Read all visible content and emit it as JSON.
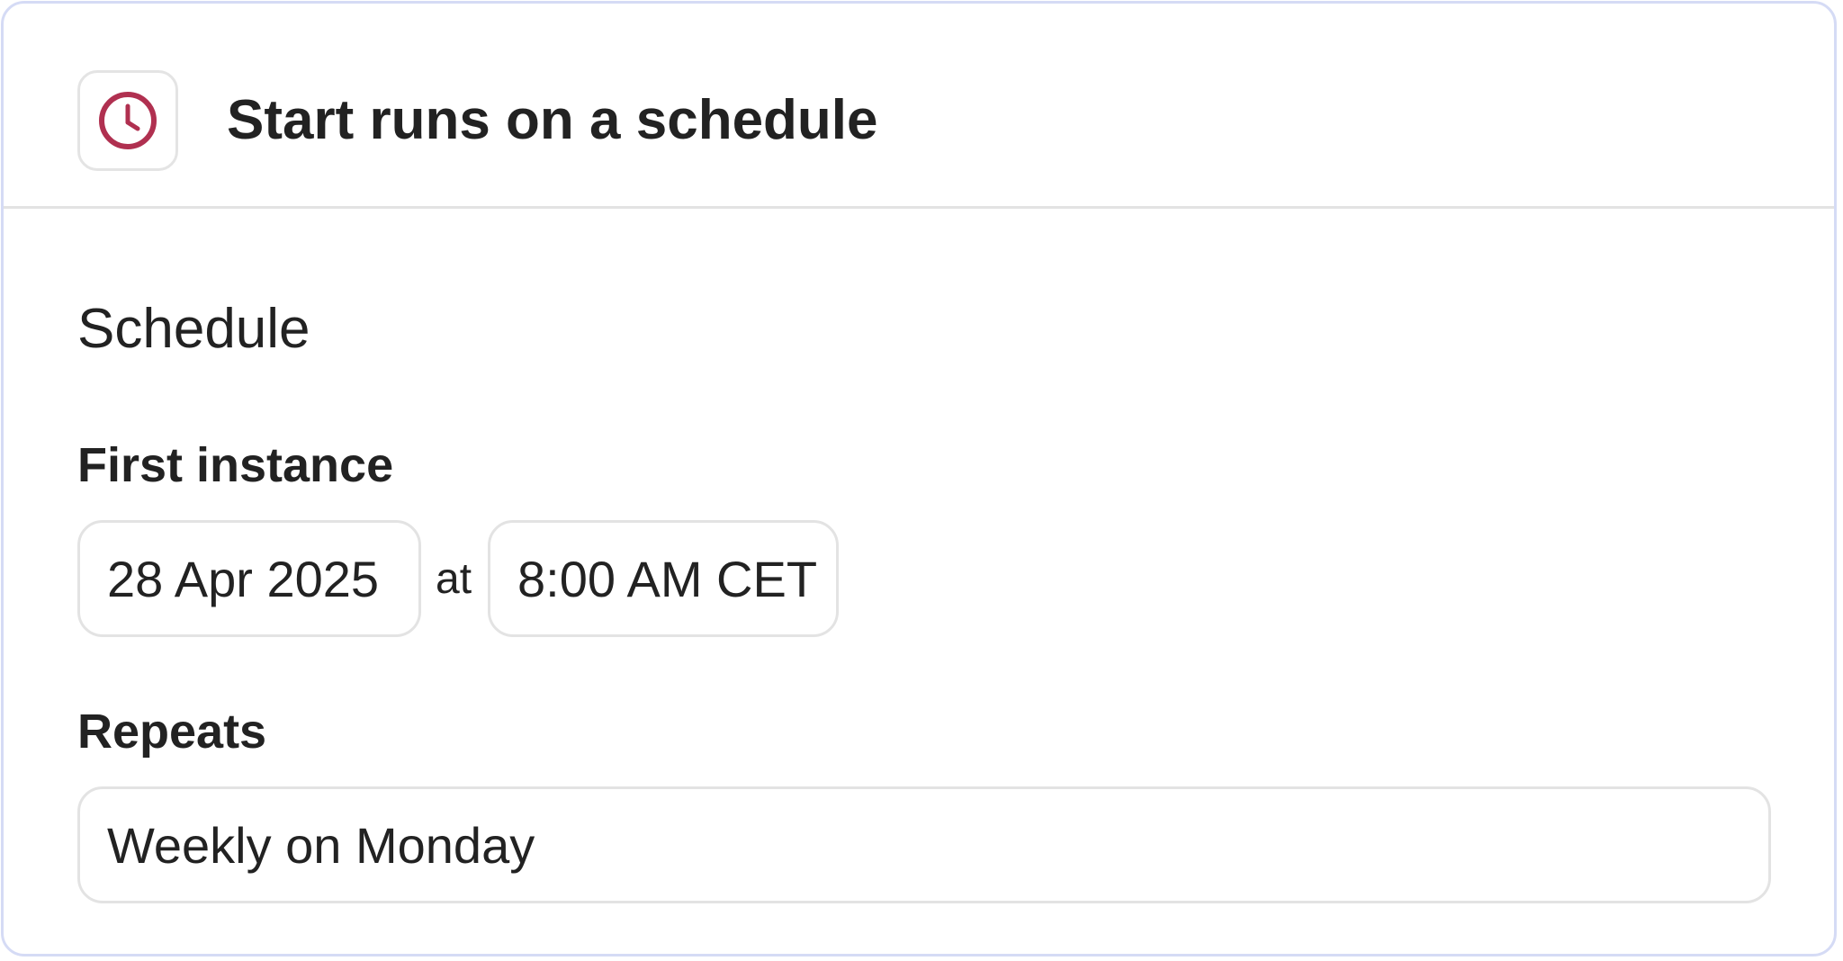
{
  "header": {
    "icon": "clock-icon",
    "icon_color": "#b03050",
    "title": "Start runs on a schedule"
  },
  "schedule": {
    "section_title": "Schedule",
    "first_instance": {
      "label": "First instance",
      "date": "28 Apr 2025",
      "connector": "at",
      "time": "8:00 AM CET"
    },
    "repeats": {
      "label": "Repeats",
      "value": "Weekly on Monday"
    }
  },
  "colors": {
    "card_border": "#d5dbf5",
    "field_border": "#e3e3e3",
    "text": "#222222"
  }
}
